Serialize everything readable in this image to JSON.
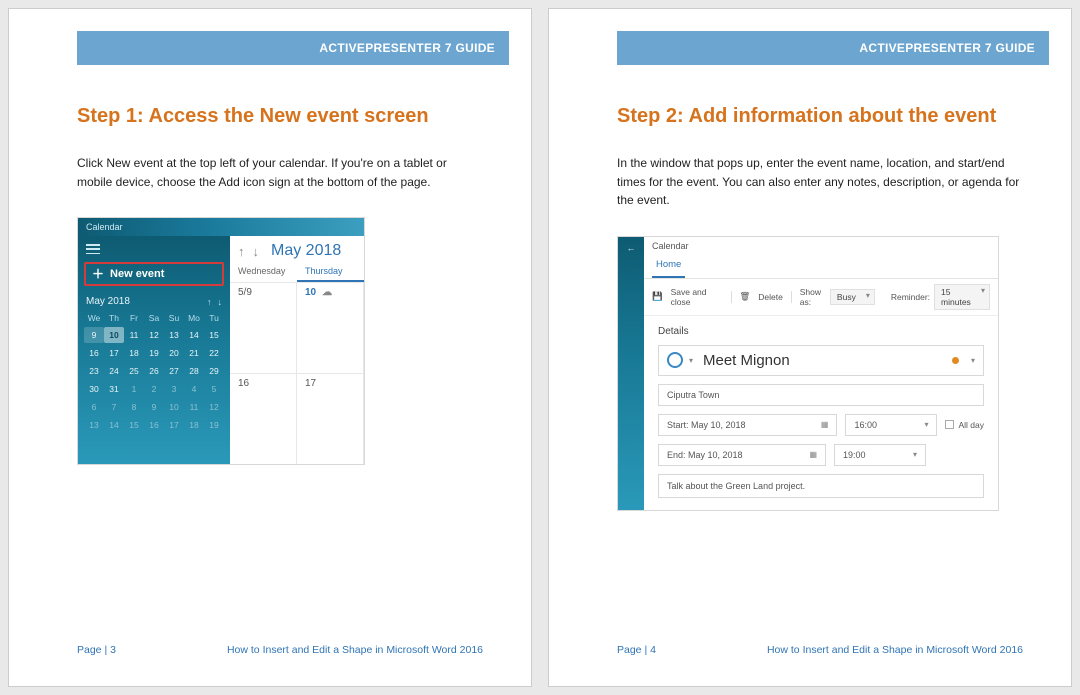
{
  "header": "ACTIVEPRESENTER 7 GUIDE",
  "footer_doc": "How to Insert and Edit a Shape in Microsoft Word 2016",
  "page1": {
    "page_label": "Page | 3",
    "title": "Step 1: Access the New event screen",
    "lead": "Click New event at the top left of your calendar. If you're on a tablet or mobile device, choose the  Add icon sign at the bottom of the page.",
    "cal": {
      "app": "Calendar",
      "new_event": "New event",
      "mini_month": "May 2018",
      "dow": [
        "We",
        "Th",
        "Fr",
        "Sa",
        "Su",
        "Mo",
        "Tu"
      ],
      "days": [
        {
          "n": "9",
          "cls": "sel"
        },
        {
          "n": "10",
          "cls": "hl"
        },
        {
          "n": "11"
        },
        {
          "n": "12"
        },
        {
          "n": "13"
        },
        {
          "n": "14"
        },
        {
          "n": "15"
        },
        {
          "n": "16"
        },
        {
          "n": "17"
        },
        {
          "n": "18"
        },
        {
          "n": "19"
        },
        {
          "n": "20"
        },
        {
          "n": "21"
        },
        {
          "n": "22"
        },
        {
          "n": "23"
        },
        {
          "n": "24"
        },
        {
          "n": "25"
        },
        {
          "n": "26"
        },
        {
          "n": "27"
        },
        {
          "n": "28"
        },
        {
          "n": "29"
        },
        {
          "n": "30"
        },
        {
          "n": "31"
        },
        {
          "n": "1",
          "cls": "dim"
        },
        {
          "n": "2",
          "cls": "dim"
        },
        {
          "n": "3",
          "cls": "dim"
        },
        {
          "n": "4",
          "cls": "dim"
        },
        {
          "n": "5",
          "cls": "dim"
        },
        {
          "n": "6",
          "cls": "dim"
        },
        {
          "n": "7",
          "cls": "dim"
        },
        {
          "n": "8",
          "cls": "dim"
        },
        {
          "n": "9",
          "cls": "dim"
        },
        {
          "n": "10",
          "cls": "dim"
        },
        {
          "n": "11",
          "cls": "dim"
        },
        {
          "n": "12",
          "cls": "dim"
        },
        {
          "n": "13",
          "cls": "dim"
        },
        {
          "n": "14",
          "cls": "dim"
        },
        {
          "n": "15",
          "cls": "dim"
        },
        {
          "n": "16",
          "cls": "dim"
        },
        {
          "n": "17",
          "cls": "dim"
        },
        {
          "n": "18",
          "cls": "dim"
        },
        {
          "n": "19",
          "cls": "dim"
        }
      ],
      "big_month": "May 2018",
      "col_wed": "Wednesday",
      "col_thu": "Thursday",
      "r1c1": "5/9",
      "r1c2": "10",
      "r2c1": "16",
      "r2c2": "17"
    }
  },
  "page2": {
    "page_label": "Page | 4",
    "title": "Step 2: Add information about the event",
    "lead": "In the window that pops up, enter the event name, location, and start/end times for the event. You can also enter any notes, description, or agenda for the event.",
    "evt": {
      "app": "Calendar",
      "tab": "Home",
      "save": "Save and close",
      "delete": "Delete",
      "showas_label": "Show as:",
      "showas_value": "Busy",
      "reminder_label": "Reminder:",
      "reminder_value": "15 minutes",
      "details": "Details",
      "name": "Meet Mignon",
      "location": "Ciputra Town",
      "start_label": "Start:",
      "start_date": "May 10, 2018",
      "start_time": "16:00",
      "end_label": "End:",
      "end_date": "May 10, 2018",
      "end_time": "19:00",
      "allday": "All day",
      "notes": "Talk about the Green Land project."
    }
  }
}
